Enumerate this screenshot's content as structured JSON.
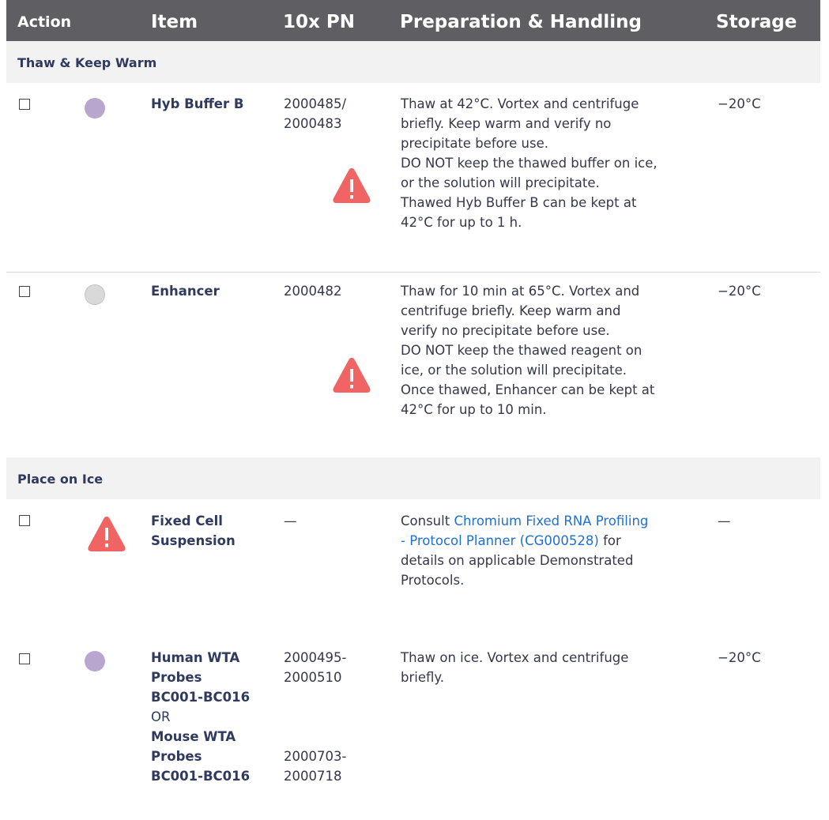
{
  "header": {
    "action": "Action",
    "item": "Item",
    "pn": "10x PN",
    "prep": "Preparation & Handling",
    "storage": "Storage"
  },
  "sections": [
    {
      "label": "Thaw & Keep Warm"
    },
    {
      "label": "Place on Ice"
    }
  ],
  "rows": [
    {
      "item": "Hyb Buffer B",
      "pn_line1": "2000485/",
      "pn_line2": "2000483",
      "prep": [
        "Thaw at 42°C. Vortex and centrifuge",
        "briefly. Keep warm and verify no",
        "precipitate before use.",
        "DO NOT keep the thawed buffer on ice,",
        "or the solution will precipitate.",
        "Thawed Hyb Buffer B can be kept at",
        "42°C for up to 1 h."
      ],
      "storage": "−20°C",
      "dot_color": "#b9a6cf"
    },
    {
      "item": "Enhancer",
      "pn_line1": "2000482",
      "prep": [
        "Thaw for 10 min at 65°C. Vortex and",
        "centrifuge briefly. Keep warm and",
        "verify no precipitate before use.",
        "DO NOT keep the thawed reagent on",
        "ice, or the solution will precipitate.",
        "Once thawed, Enhancer can be kept at",
        "42°C for up to 10 min."
      ],
      "storage": "−20°C",
      "dot_color": "#d9d9d9"
    },
    {
      "item_line1": "Fixed Cell",
      "item_line2": "Suspension",
      "pn": "—",
      "prep_prefix": "Consult ",
      "prep_link_line1": "Chromium Fixed RNA Profiling",
      "prep_link_line2": "- Protocol Planner (CG000528)",
      "prep_suffix_line2": " for",
      "prep_line3": "details on applicable Demonstrated",
      "prep_line4": "Protocols.",
      "storage": "—"
    },
    {
      "item_a_line1": "Human WTA",
      "item_a_line2": "Probes",
      "item_a_line3": "BC001-BC016",
      "or": "OR",
      "item_b_line1": "Mouse WTA",
      "item_b_line2": "Probes",
      "item_b_line3": "BC001-BC016",
      "pn_a_line1": "2000495-",
      "pn_a_line2": "2000510",
      "pn_b_line1": "2000703-",
      "pn_b_line2": "2000718",
      "prep_line1": "Thaw on ice. Vortex and centrifuge",
      "prep_line2": "briefly.",
      "storage": "−20°C",
      "dot_color": "#b9a6cf"
    }
  ],
  "colors": {
    "header_bg": "#5f5f63",
    "section_bg": "#f2f2f2",
    "warning": "#f06464",
    "link": "#1f6fd6"
  }
}
